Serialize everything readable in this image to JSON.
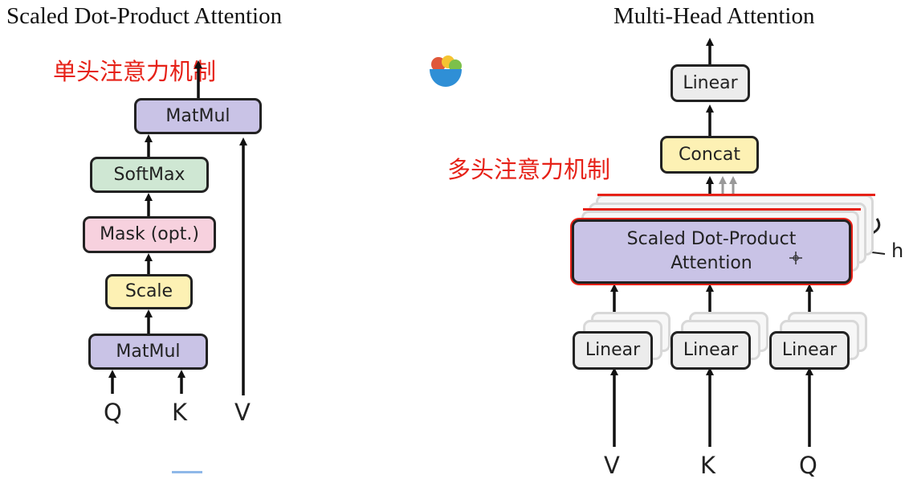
{
  "left": {
    "title": "Scaled Dot-Product Attention",
    "annotation": "单头注意力机制",
    "boxes": {
      "matmul_top": "MatMul",
      "softmax": "SoftMax",
      "mask": "Mask (opt.)",
      "scale": "Scale",
      "matmul_bottom": "MatMul"
    },
    "inputs": [
      "Q",
      "K",
      "V"
    ]
  },
  "right": {
    "title": "Multi-Head Attention",
    "annotation": "多头注意力机制",
    "boxes": {
      "linear_top": "Linear",
      "concat": "Concat",
      "sdpa_line1": "Scaled Dot-Product",
      "sdpa_line2": "Attention",
      "linear_v": "Linear",
      "linear_k": "Linear",
      "linear_q": "Linear"
    },
    "h_label": "h",
    "inputs": [
      "V",
      "K",
      "Q"
    ],
    "highlight_color": "#e62117"
  },
  "icons": [
    "salad-bowl-icon",
    "crosshair-cursor-icon"
  ]
}
